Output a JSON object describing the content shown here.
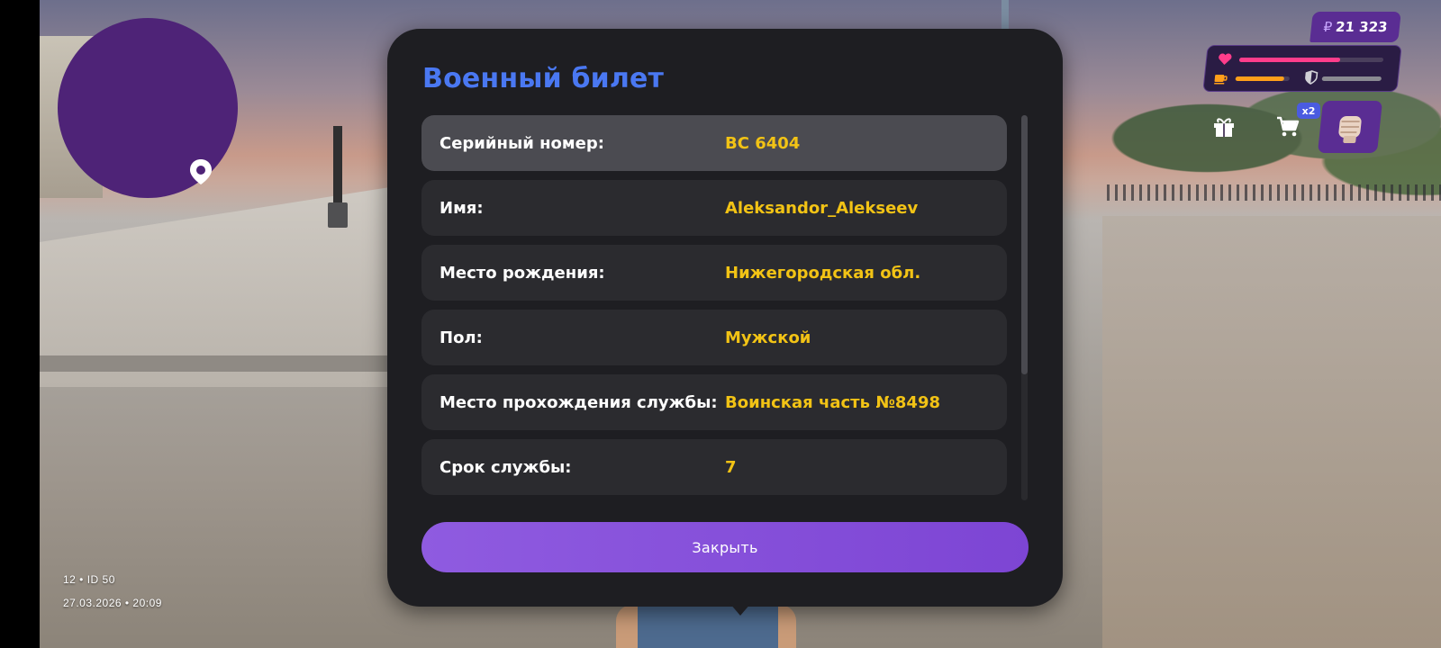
{
  "dialog": {
    "title": "Военный билет",
    "rows": [
      {
        "label": "Серийный номер:",
        "value": "ВС 6404"
      },
      {
        "label": "Имя:",
        "value": "Aleksandor_Alekseev"
      },
      {
        "label": "Место рождения:",
        "value": "Нижегородская обл."
      },
      {
        "label": "Пол:",
        "value": "Мужской"
      },
      {
        "label": "Место прохождения службы:",
        "value": "Воинская часть №8498"
      },
      {
        "label": "Срок службы:",
        "value": "7"
      }
    ],
    "close_label": "Закрыть",
    "scroll_position_fraction": 0.0
  },
  "hud": {
    "currency_symbol": "₽",
    "money": "21 323",
    "health_level_fraction": 0.7,
    "hunger_level_fraction": 0.9,
    "armor_level_fraction": 0.0,
    "shop_multiplier": "x2",
    "icons": [
      "map-pin-icon",
      "heart-icon",
      "food-cup-icon",
      "shield-icon",
      "gift-icon",
      "cart-icon",
      "fist-icon"
    ]
  },
  "footer": {
    "line1": "12 • ID 50",
    "line2": "27.03.2026 • 20:09"
  },
  "colors": {
    "title": "#4a78f2",
    "value": "#f2c315",
    "accent_purple": "#8f5be0",
    "minimap": "#4e2377",
    "health": "#ff3d8b",
    "hunger": "#ff9f1a"
  }
}
